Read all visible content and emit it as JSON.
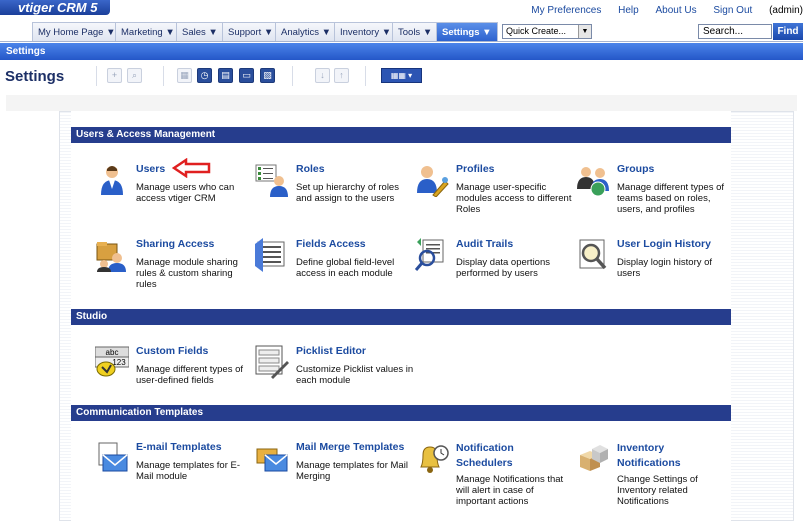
{
  "app": {
    "logo": "vtiger CRM 5"
  },
  "toplinks": {
    "prefs": "My Preferences",
    "help": "Help",
    "about": "About Us",
    "signout": "Sign Out",
    "user": "(admin)"
  },
  "tabs": [
    "My Home Page ▼",
    "Marketing ▼",
    "Sales ▼",
    "Support ▼",
    "Analytics ▼",
    "Inventory ▼",
    "Tools ▼",
    "Settings ▼"
  ],
  "quick_create": {
    "value": "Quick Create..."
  },
  "search": {
    "value": "Search...",
    "button": "Find"
  },
  "bar": {
    "title": "Settings"
  },
  "page": {
    "title": "Settings"
  },
  "sections": {
    "users_access": "Users & Access Management",
    "studio": "Studio",
    "comm": "Communication Templates"
  },
  "items": {
    "users": {
      "title": "Users",
      "desc": "Manage users who can access vtiger CRM"
    },
    "roles": {
      "title": "Roles",
      "desc": "Set up hierarchy of roles and assign to the users"
    },
    "profiles": {
      "title": "Profiles",
      "desc": "Manage user-specific modules access to different Roles"
    },
    "groups": {
      "title": "Groups",
      "desc": "Manage different types of teams based on roles, users, and profiles"
    },
    "sharing": {
      "title": "Sharing Access",
      "desc": "Manage module sharing rules & custom sharing rules"
    },
    "fields": {
      "title": "Fields Access",
      "desc": "Define global field-level access in each module"
    },
    "audit": {
      "title": "Audit Trails",
      "desc": "Display data opertions performed by users"
    },
    "loginhist": {
      "title": "User Login History",
      "desc": "Display login history of users"
    },
    "customfields": {
      "title": "Custom Fields",
      "desc": "Manage different types of user-defined fields"
    },
    "picklist": {
      "title": "Picklist Editor",
      "desc": "Customize Picklist values in each module"
    },
    "email": {
      "title": "E-mail Templates",
      "desc": "Manage templates for E-Mail module"
    },
    "mailmerge": {
      "title": "Mail Merge Templates",
      "desc": "Manage templates for Mail Merging"
    },
    "notif": {
      "title": "Notification Schedulers",
      "desc": "Manage Notifications that will alert in case of important actions"
    },
    "inventory": {
      "title": "Inventory Notifications",
      "desc": "Change Settings of Inventory related Notifications"
    }
  },
  "colors": {
    "accent": "#1c4ba0",
    "section": "#263d8d",
    "arrow": "#e02020"
  }
}
